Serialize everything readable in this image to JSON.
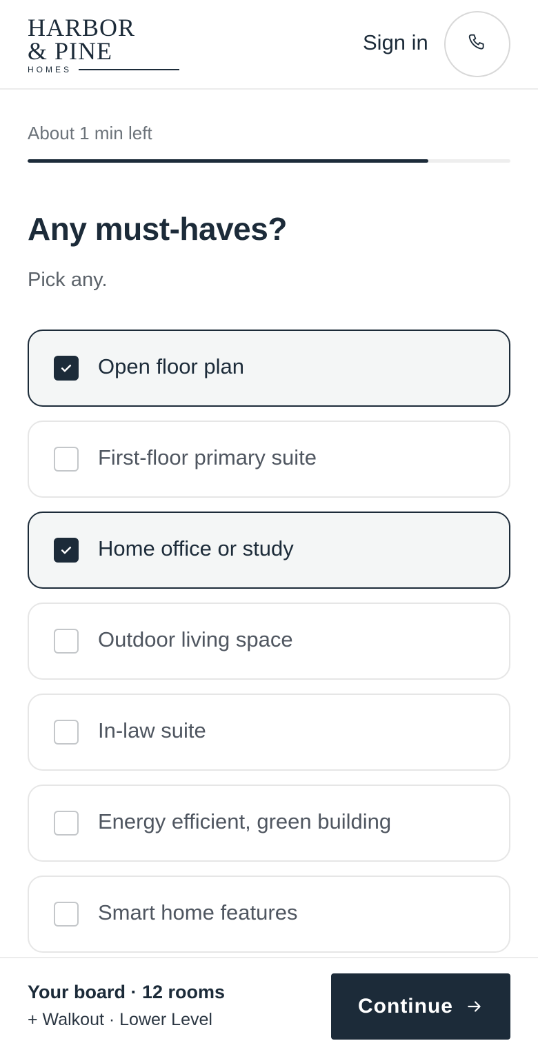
{
  "header": {
    "logo_line1": "HARBOR",
    "logo_line2": "& PINE",
    "logo_sub": "HOMES",
    "signin_label": "Sign in"
  },
  "progress": {
    "text": "About 1 min left",
    "fraction": 0.83
  },
  "question": {
    "title": "Any must-haves?",
    "subtitle": "Pick any."
  },
  "options": [
    {
      "label": "Open floor plan",
      "selected": true
    },
    {
      "label": "First-floor primary suite",
      "selected": false
    },
    {
      "label": "Home office or study",
      "selected": true
    },
    {
      "label": "Outdoor living space",
      "selected": false
    },
    {
      "label": "In-law suite",
      "selected": false
    },
    {
      "label": "Energy efficient, green building",
      "selected": false
    },
    {
      "label": "Smart home features",
      "selected": false
    }
  ],
  "footer": {
    "board_title": "Your board · 12 rooms",
    "board_sub": "+ Walkout · Lower Level",
    "continue_label": "Continue"
  },
  "colors": {
    "primary": "#1c2b39",
    "selected_bg": "#f4f6f6",
    "border": "#e6e6e6"
  },
  "icons": {
    "phone": "phone-icon",
    "check": "check-icon",
    "arrow": "arrow-right-icon"
  }
}
